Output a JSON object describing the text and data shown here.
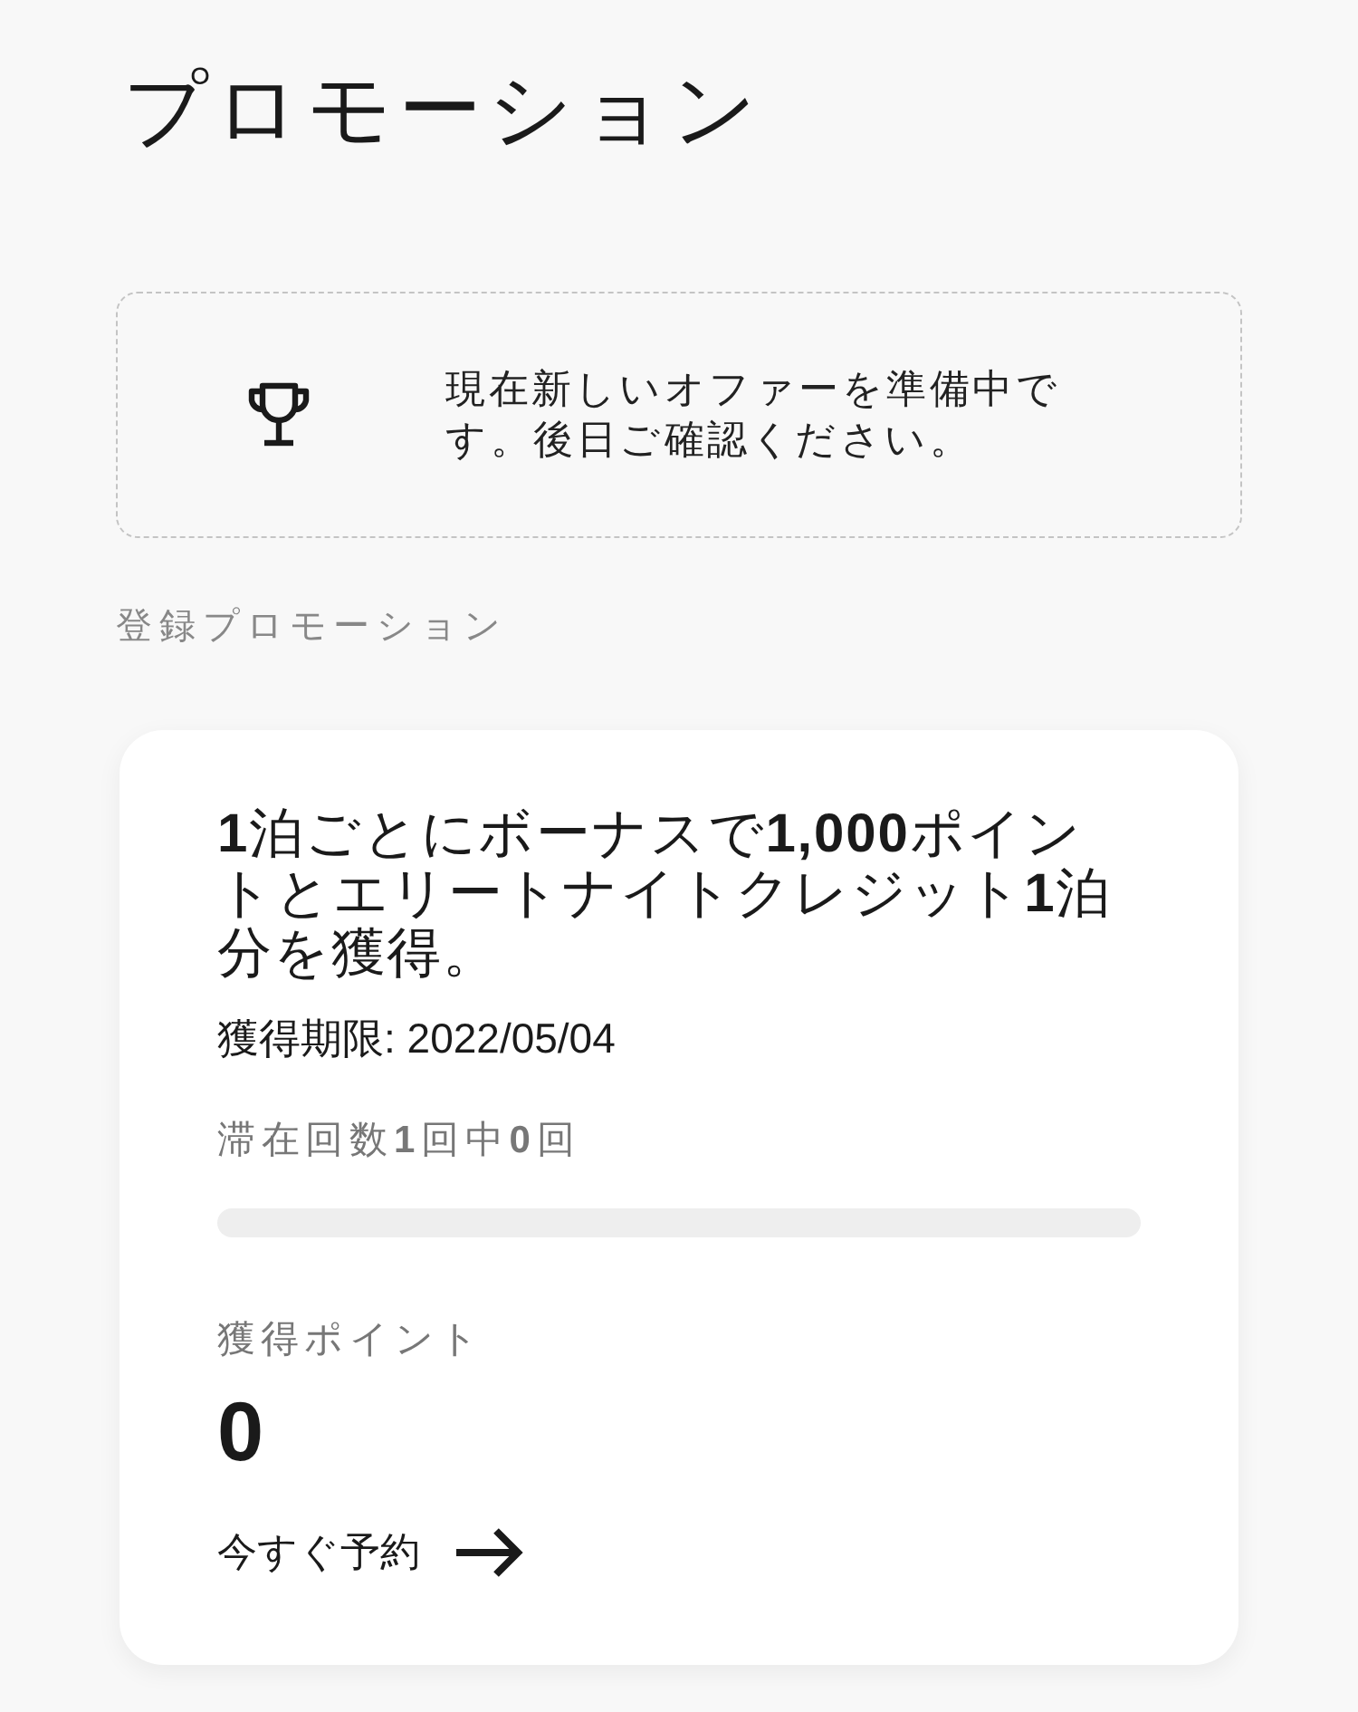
{
  "page": {
    "title": "プロモーション"
  },
  "empty_offer": {
    "message": "現在新しいオファーを準備中です。後日ご確認ください。"
  },
  "section_label": "登録プロモーション",
  "promotions": [
    {
      "title": "**1**泊ごとにボーナスで**1,000**ポイントとエリートナイトクレジット**1**泊分を獲得。",
      "expiry": "獲得期限: 2022/05/04",
      "progress_label": "滞在回数**1**回中**0**回",
      "points_label": "獲得ポイント",
      "points": "0",
      "action": "今すぐ予約"
    }
  ]
}
